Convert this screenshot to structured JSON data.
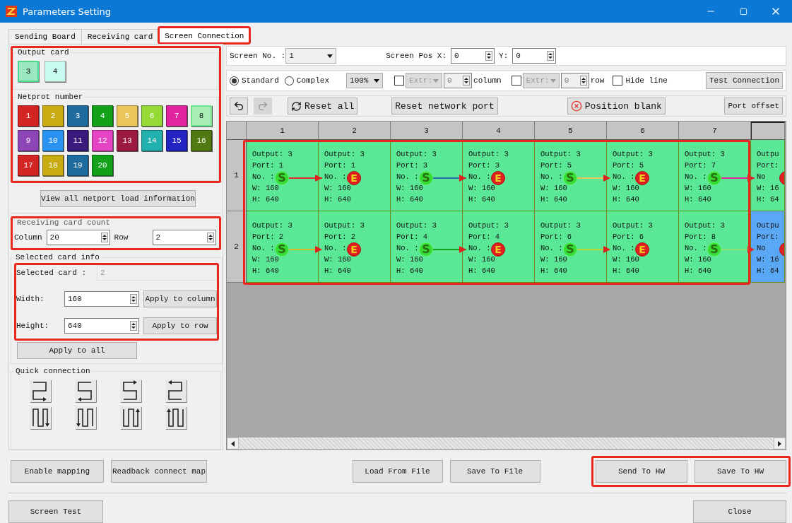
{
  "window": {
    "title": "Parameters Setting"
  },
  "tabs": [
    {
      "label": "Sending Board",
      "selected": false,
      "highlighted": false
    },
    {
      "label": "Receiving card",
      "selected": false,
      "highlighted": false
    },
    {
      "label": "Screen Connection",
      "selected": true,
      "highlighted": true
    }
  ],
  "card_panel": {
    "highlighted": true,
    "output_title": "Output card",
    "output_cards": [
      {
        "label": "3",
        "selected": true
      },
      {
        "label": "4",
        "selected": false
      }
    ],
    "port_title": "Netprot number",
    "ports": [
      {
        "label": "1",
        "color": "#d42323",
        "selected": false
      },
      {
        "label": "2",
        "color": "#c9ab12",
        "selected": false
      },
      {
        "label": "3",
        "color": "#1f6b9e",
        "selected": false
      },
      {
        "label": "4",
        "color": "#12a118",
        "selected": false
      },
      {
        "label": "5",
        "color": "#e9c55a",
        "selected": false
      },
      {
        "label": "6",
        "color": "#96da35",
        "selected": false
      },
      {
        "label": "7",
        "color": "#e2239f",
        "selected": false
      },
      {
        "label": "8",
        "color": "#a9eeb4",
        "selected": true
      },
      {
        "label": "9",
        "color": "#8e45b5",
        "selected": false
      },
      {
        "label": "10",
        "color": "#2a93f2",
        "selected": false
      },
      {
        "label": "11",
        "color": "#3b1a7e",
        "selected": false
      },
      {
        "label": "12",
        "color": "#e545c4",
        "selected": false
      },
      {
        "label": "13",
        "color": "#9c1a42",
        "selected": false
      },
      {
        "label": "14",
        "color": "#23b1b0",
        "selected": false
      },
      {
        "label": "15",
        "color": "#2324c2",
        "selected": false
      },
      {
        "label": "16",
        "color": "#527a12",
        "selected": false
      },
      {
        "label": "17",
        "color": "#d42323",
        "selected": false
      },
      {
        "label": "18",
        "color": "#c9ab12",
        "selected": false
      },
      {
        "label": "19",
        "color": "#1f6b9e",
        "selected": false
      },
      {
        "label": "20",
        "color": "#12a118",
        "selected": false
      }
    ]
  },
  "view_load_button": "View all netport load information",
  "card_count": {
    "highlighted": true,
    "title": "Receiving card count",
    "column_label": "Column",
    "column_value": "20",
    "row_label": "Row",
    "row_value": "2"
  },
  "selected_info": {
    "title": "Selected card info",
    "selected_label": "Selected card :",
    "selected_value": "2",
    "highlighted": true,
    "width_label": "Width:",
    "width_value": "160",
    "apply_column": "Apply to column",
    "height_label": "Height:",
    "height_value": "640",
    "apply_row": "Apply to  row",
    "apply_all": "Apply to all"
  },
  "quick_connection": {
    "title": "Quick connection",
    "patterns": [
      {
        "kind": "zright"
      },
      {
        "kind": "zleft"
      },
      {
        "kind": "uright"
      },
      {
        "kind": "uleft"
      },
      {
        "kind": "downright"
      },
      {
        "kind": "downleft"
      },
      {
        "kind": "upright"
      },
      {
        "kind": "upleft"
      }
    ]
  },
  "screen_bar": {
    "screen_no_label": "Screen No. :",
    "screen_no_value": "1",
    "pos_x_label": "Screen Pos X:",
    "pos_x_value": "0",
    "pos_y_label": "Y:",
    "pos_y_value": "0"
  },
  "mode_bar": {
    "modes": [
      {
        "label": "Standard",
        "selected": true
      },
      {
        "label": "Complex",
        "selected": false
      }
    ],
    "zoom": "100%",
    "extras": [
      {
        "checked": false,
        "select": "Extr:",
        "value": "0",
        "label": "column",
        "disabled": true
      },
      {
        "checked": false,
        "select": "Extr:",
        "value": "0",
        "label": "row",
        "disabled": true
      }
    ],
    "hide_line": {
      "label": "Hide line",
      "checked": false
    },
    "test_button": "Test Connection"
  },
  "action_bar": {
    "undo_disabled": false,
    "redo_disabled": true,
    "reset_all": "Reset all",
    "reset_port": "Reset network port",
    "position_blank": "Position blank",
    "port_offset": "Port offset"
  },
  "grid": {
    "highlighted": true,
    "columns": [
      "1",
      "2",
      "3",
      "4",
      "5",
      "6",
      "7"
    ],
    "rows": [
      {
        "label": "1",
        "cells": [
          {
            "lines": [
              "Output: 3",
              "Port: 1",
              "No. :",
              "W: 160",
              "H: 640"
            ],
            "marker": {
              "kind": "start",
              "label": "S"
            },
            "link": {
              "color": "#e52a2a"
            },
            "selected": false
          },
          {
            "lines": [
              "Output: 3",
              "Port: 1",
              "No. :",
              "W: 160",
              "H: 640"
            ],
            "marker": {
              "kind": "end",
              "label": "E"
            },
            "selected": false
          },
          {
            "lines": [
              "Output: 3",
              "Port: 3",
              "No. :",
              "W: 160",
              "H: 640"
            ],
            "marker": {
              "kind": "start",
              "label": "S"
            },
            "link": {
              "color": "#2b6fa8"
            },
            "selected": false
          },
          {
            "lines": [
              "Output: 3",
              "Port: 3",
              "No. :",
              "W: 160",
              "H: 640"
            ],
            "marker": {
              "kind": "end",
              "label": "E"
            },
            "selected": false
          },
          {
            "lines": [
              "Output: 3",
              "Port: 5",
              "No. :",
              "W: 160",
              "H: 640"
            ],
            "marker": {
              "kind": "start",
              "label": "S"
            },
            "link": {
              "color": "#e9c55a"
            },
            "selected": false
          },
          {
            "lines": [
              "Output: 3",
              "Port: 5",
              "No. :",
              "W: 160",
              "H: 640"
            ],
            "marker": {
              "kind": "end",
              "label": "E"
            },
            "selected": false
          },
          {
            "lines": [
              "Output: 3",
              "Port: 7",
              "No. :",
              "W: 160",
              "H: 640"
            ],
            "marker": {
              "kind": "start",
              "label": "S"
            },
            "link": {
              "color": "#e2239f"
            },
            "selected": false
          },
          {
            "lines": [
              "Outpu",
              "Port:",
              "No",
              "W: 16",
              "H: 64"
            ],
            "marker": {
              "kind": "end"
            },
            "selected": false
          }
        ]
      },
      {
        "label": "2",
        "cells": [
          {
            "lines": [
              "Output: 3",
              "Port: 2",
              "No. :",
              "W: 160",
              "H: 640"
            ],
            "marker": {
              "kind": "start",
              "label": "S"
            },
            "link": {
              "color": "#d9b820"
            },
            "selected": false
          },
          {
            "lines": [
              "Output: 3",
              "Port: 2",
              "No. :",
              "W: 160",
              "H: 640"
            ],
            "marker": {
              "kind": "end",
              "label": "E"
            },
            "selected": false
          },
          {
            "lines": [
              "Output: 3",
              "Port: 4",
              "No. :",
              "W: 160",
              "H: 640"
            ],
            "marker": {
              "kind": "start",
              "label": "S"
            },
            "link": {
              "color": "#12a118"
            },
            "selected": false
          },
          {
            "lines": [
              "Output: 3",
              "Port: 4",
              "No. :",
              "W: 160",
              "H: 640"
            ],
            "marker": {
              "kind": "end",
              "label": "E"
            },
            "selected": false
          },
          {
            "lines": [
              "Output: 3",
              "Port: 6",
              "No. :",
              "W: 160",
              "H: 640"
            ],
            "marker": {
              "kind": "start",
              "label": "S"
            },
            "link": {
              "color": "#b8d830"
            },
            "selected": false
          },
          {
            "lines": [
              "Output: 3",
              "Port: 6",
              "No. :",
              "W: 160",
              "H: 640"
            ],
            "marker": {
              "kind": "end",
              "label": "E"
            },
            "selected": false
          },
          {
            "lines": [
              "Output: 3",
              "Port: 8",
              "No. :",
              "W: 160",
              "H: 640"
            ],
            "marker": {
              "kind": "start",
              "label": "S"
            },
            "link": {
              "color": "#8fe070"
            },
            "selected": false
          },
          {
            "lines": [
              "Outpu",
              "Port:",
              "No",
              "W: 16",
              "H: 64"
            ],
            "marker": {
              "kind": "end"
            },
            "selected": true
          }
        ]
      }
    ]
  },
  "bottom_bar": {
    "left": [
      "Enable mapping",
      "Readback connect map"
    ],
    "center": [
      "Load From File",
      "Save To File"
    ],
    "right": [
      "Send To HW",
      "Save To HW"
    ],
    "right_highlighted": true,
    "footer_left": "Screen Test",
    "footer_right": "Close"
  }
}
